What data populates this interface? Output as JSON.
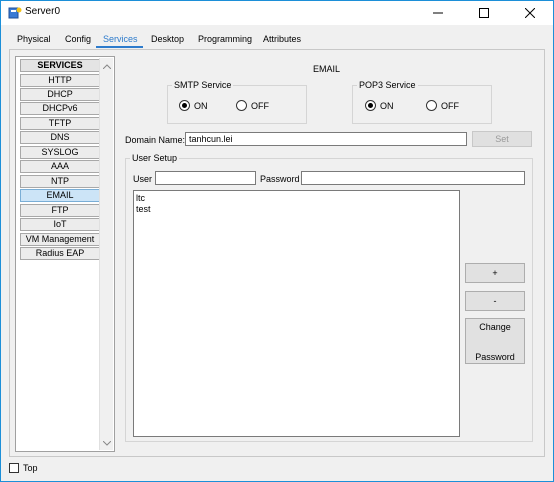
{
  "window": {
    "title": "Server0",
    "controls": [
      "minimize-icon",
      "maximize-icon",
      "close-icon"
    ]
  },
  "tabs": [
    {
      "label": "Physical",
      "active": false
    },
    {
      "label": "Config",
      "active": false
    },
    {
      "label": "Services",
      "active": true
    },
    {
      "label": "Desktop",
      "active": false
    },
    {
      "label": "Programming",
      "active": false
    },
    {
      "label": "Attributes",
      "active": false
    }
  ],
  "sidebar": {
    "header": "SERVICES",
    "items": [
      {
        "label": "HTTP"
      },
      {
        "label": "DHCP"
      },
      {
        "label": "DHCPv6"
      },
      {
        "label": "TFTP"
      },
      {
        "label": "DNS"
      },
      {
        "label": "SYSLOG"
      },
      {
        "label": "AAA"
      },
      {
        "label": "NTP"
      },
      {
        "label": "EMAIL",
        "selected": true
      },
      {
        "label": "FTP"
      },
      {
        "label": "IoT"
      },
      {
        "label": "VM Management"
      },
      {
        "label": "Radius EAP"
      }
    ]
  },
  "email": {
    "title": "EMAIL",
    "smtp": {
      "legend": "SMTP Service",
      "on_label": "ON",
      "off_label": "OFF",
      "selected": "ON"
    },
    "pop3": {
      "legend": "POP3 Service",
      "on_label": "ON",
      "off_label": "OFF",
      "selected": "ON"
    },
    "domain": {
      "label": "Domain Name:",
      "value": "tanhcun.lei",
      "set_label": "Set"
    },
    "user_setup": {
      "legend": "User Setup",
      "user_label": "User",
      "user_value": "",
      "password_label": "Password",
      "password_value": "",
      "users": [
        "ltc",
        "test"
      ],
      "add_label": "+",
      "remove_label": "-",
      "change_password_line1": "Change",
      "change_password_line2": "Password"
    }
  },
  "footer": {
    "top_label": "Top",
    "top_checked": false
  },
  "colors": {
    "accent": "#2d7bcc",
    "title_border": "#1c8fd8",
    "selected_bg": "#cce4f7"
  }
}
